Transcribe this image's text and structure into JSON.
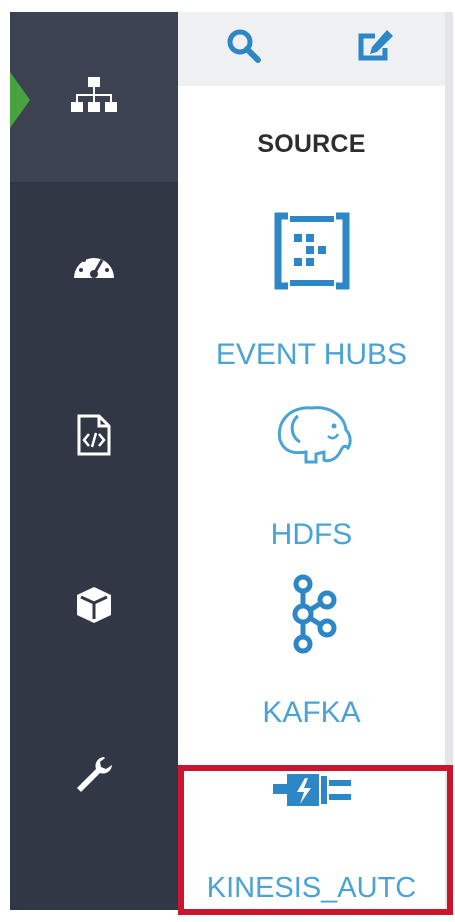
{
  "rail": {
    "items": [
      {
        "icon": "sitemap-icon",
        "active": true
      },
      {
        "icon": "dashboard-gauge-icon",
        "active": false
      },
      {
        "icon": "code-file-icon",
        "active": false
      },
      {
        "icon": "cube-icon",
        "active": false
      },
      {
        "icon": "wrench-icon",
        "active": false
      }
    ]
  },
  "toolbar": {
    "search_icon": "search-icon",
    "edit_icon": "edit-icon"
  },
  "panel": {
    "title": "SOURCE",
    "items": [
      {
        "label": "EVENT HUBS",
        "icon": "event-hubs-icon"
      },
      {
        "label": "HDFS",
        "icon": "hadoop-elephant-icon"
      },
      {
        "label": "KAFKA",
        "icon": "kafka-icon"
      },
      {
        "label": "KINESIS_AUTC",
        "icon": "plug-icon"
      }
    ]
  },
  "colors": {
    "rail": "#323745",
    "rail_active": "#3d4252",
    "active_marker": "#48a23f",
    "accent": "#4aa3d4",
    "icon_blue": "#2d86c5",
    "highlight": "#c9152d"
  }
}
